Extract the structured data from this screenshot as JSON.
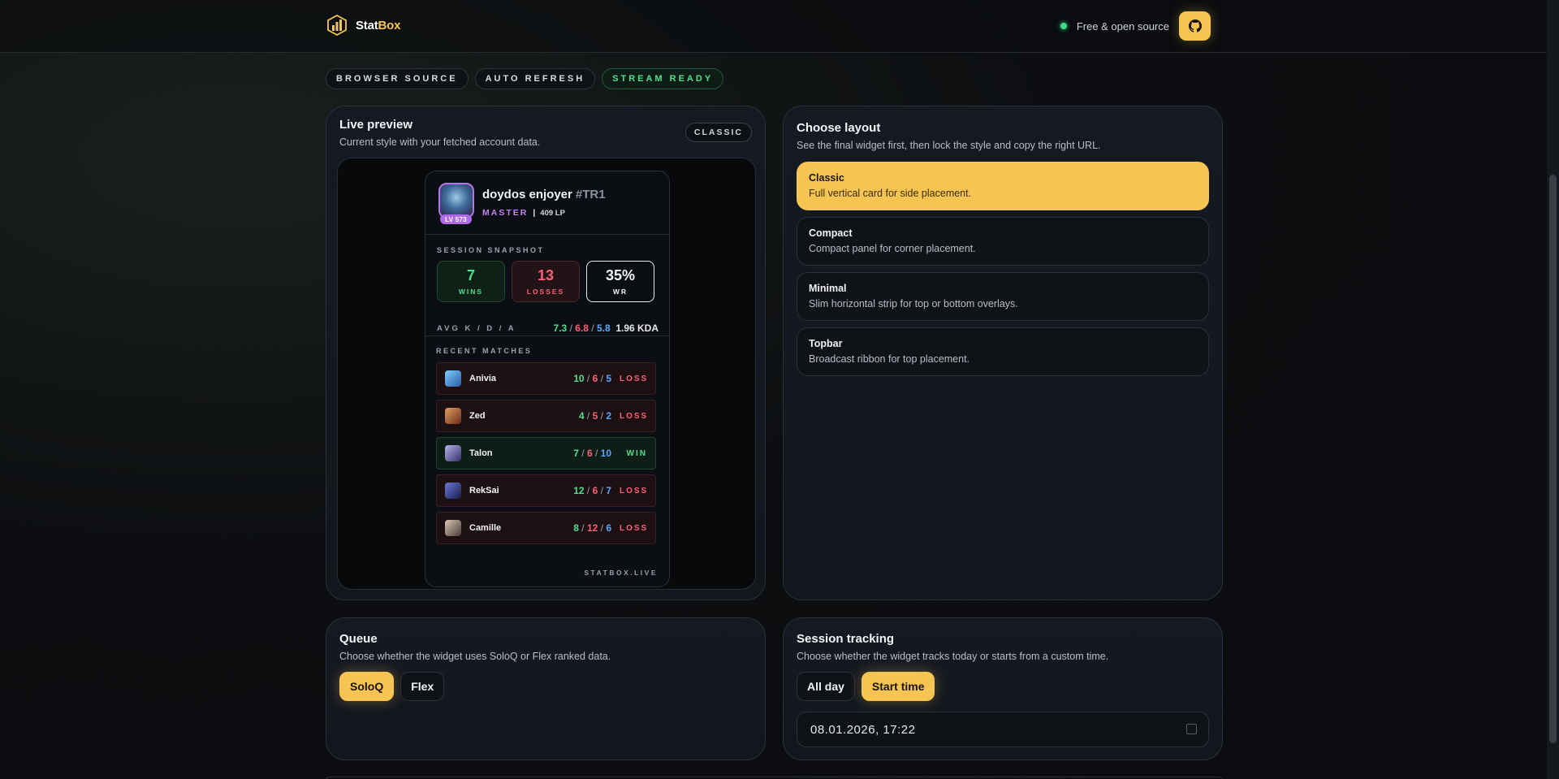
{
  "brand": {
    "name_part1": "Stat",
    "name_part2": "Box"
  },
  "header": {
    "note": "Free & open source",
    "github_icon": "github-icon"
  },
  "chips": [
    "BROWSER SOURCE",
    "AUTO REFRESH",
    "STREAM READY"
  ],
  "preview": {
    "title": "Live preview",
    "subtitle": "Current style with your fetched account data.",
    "style_tag": "CLASSIC",
    "player": {
      "name": "doydos enjoyer",
      "tag": "#TR1",
      "level": "LV 573",
      "rank": "MASTER",
      "lp": "409 LP"
    },
    "session_label": "SESSION SNAPSHOT",
    "wins": {
      "value": "7",
      "label": "WINS"
    },
    "losses": {
      "value": "13",
      "label": "LOSSES"
    },
    "winrate": {
      "value": "35%",
      "label": "WR"
    },
    "avg_label": "AVG K / D / A",
    "avg": {
      "k": "7.3",
      "d": "6.8",
      "a": "5.8",
      "kda": "1.96 KDA"
    },
    "recent_label": "RECENT MATCHES",
    "matches": [
      {
        "champion": "Anivia",
        "k": "10",
        "d": "6",
        "a": "5",
        "result": "LOSS"
      },
      {
        "champion": "Zed",
        "k": "4",
        "d": "5",
        "a": "2",
        "result": "LOSS"
      },
      {
        "champion": "Talon",
        "k": "7",
        "d": "6",
        "a": "10",
        "result": "WIN"
      },
      {
        "champion": "RekSai",
        "k": "12",
        "d": "6",
        "a": "7",
        "result": "LOSS"
      },
      {
        "champion": "Camille",
        "k": "8",
        "d": "12",
        "a": "6",
        "result": "LOSS"
      }
    ],
    "footer": "STATBOX.LIVE"
  },
  "layout": {
    "title": "Choose layout",
    "subtitle": "See the final widget first, then lock the style and copy the right URL.",
    "options": [
      {
        "title": "Classic",
        "desc": "Full vertical card for side placement."
      },
      {
        "title": "Compact",
        "desc": "Compact panel for corner placement."
      },
      {
        "title": "Minimal",
        "desc": "Slim horizontal strip for top or bottom overlays."
      },
      {
        "title": "Topbar",
        "desc": "Broadcast ribbon for top placement."
      }
    ]
  },
  "queue": {
    "title": "Queue",
    "subtitle": "Choose whether the widget uses SoloQ or Flex ranked data.",
    "soloq": "SoloQ",
    "flex": "Flex"
  },
  "session": {
    "title": "Session tracking",
    "subtitle": "Choose whether the widget tracks today or starts from a custom time.",
    "all_day": "All day",
    "start_time": "Start time",
    "datetime": "08.01.2026, 17:22"
  },
  "colors": {
    "accent": "#f6c453",
    "win": "#4ee08c",
    "loss": "#ff5f78",
    "assist": "#5aa9ff",
    "rank": "#c584f4"
  }
}
